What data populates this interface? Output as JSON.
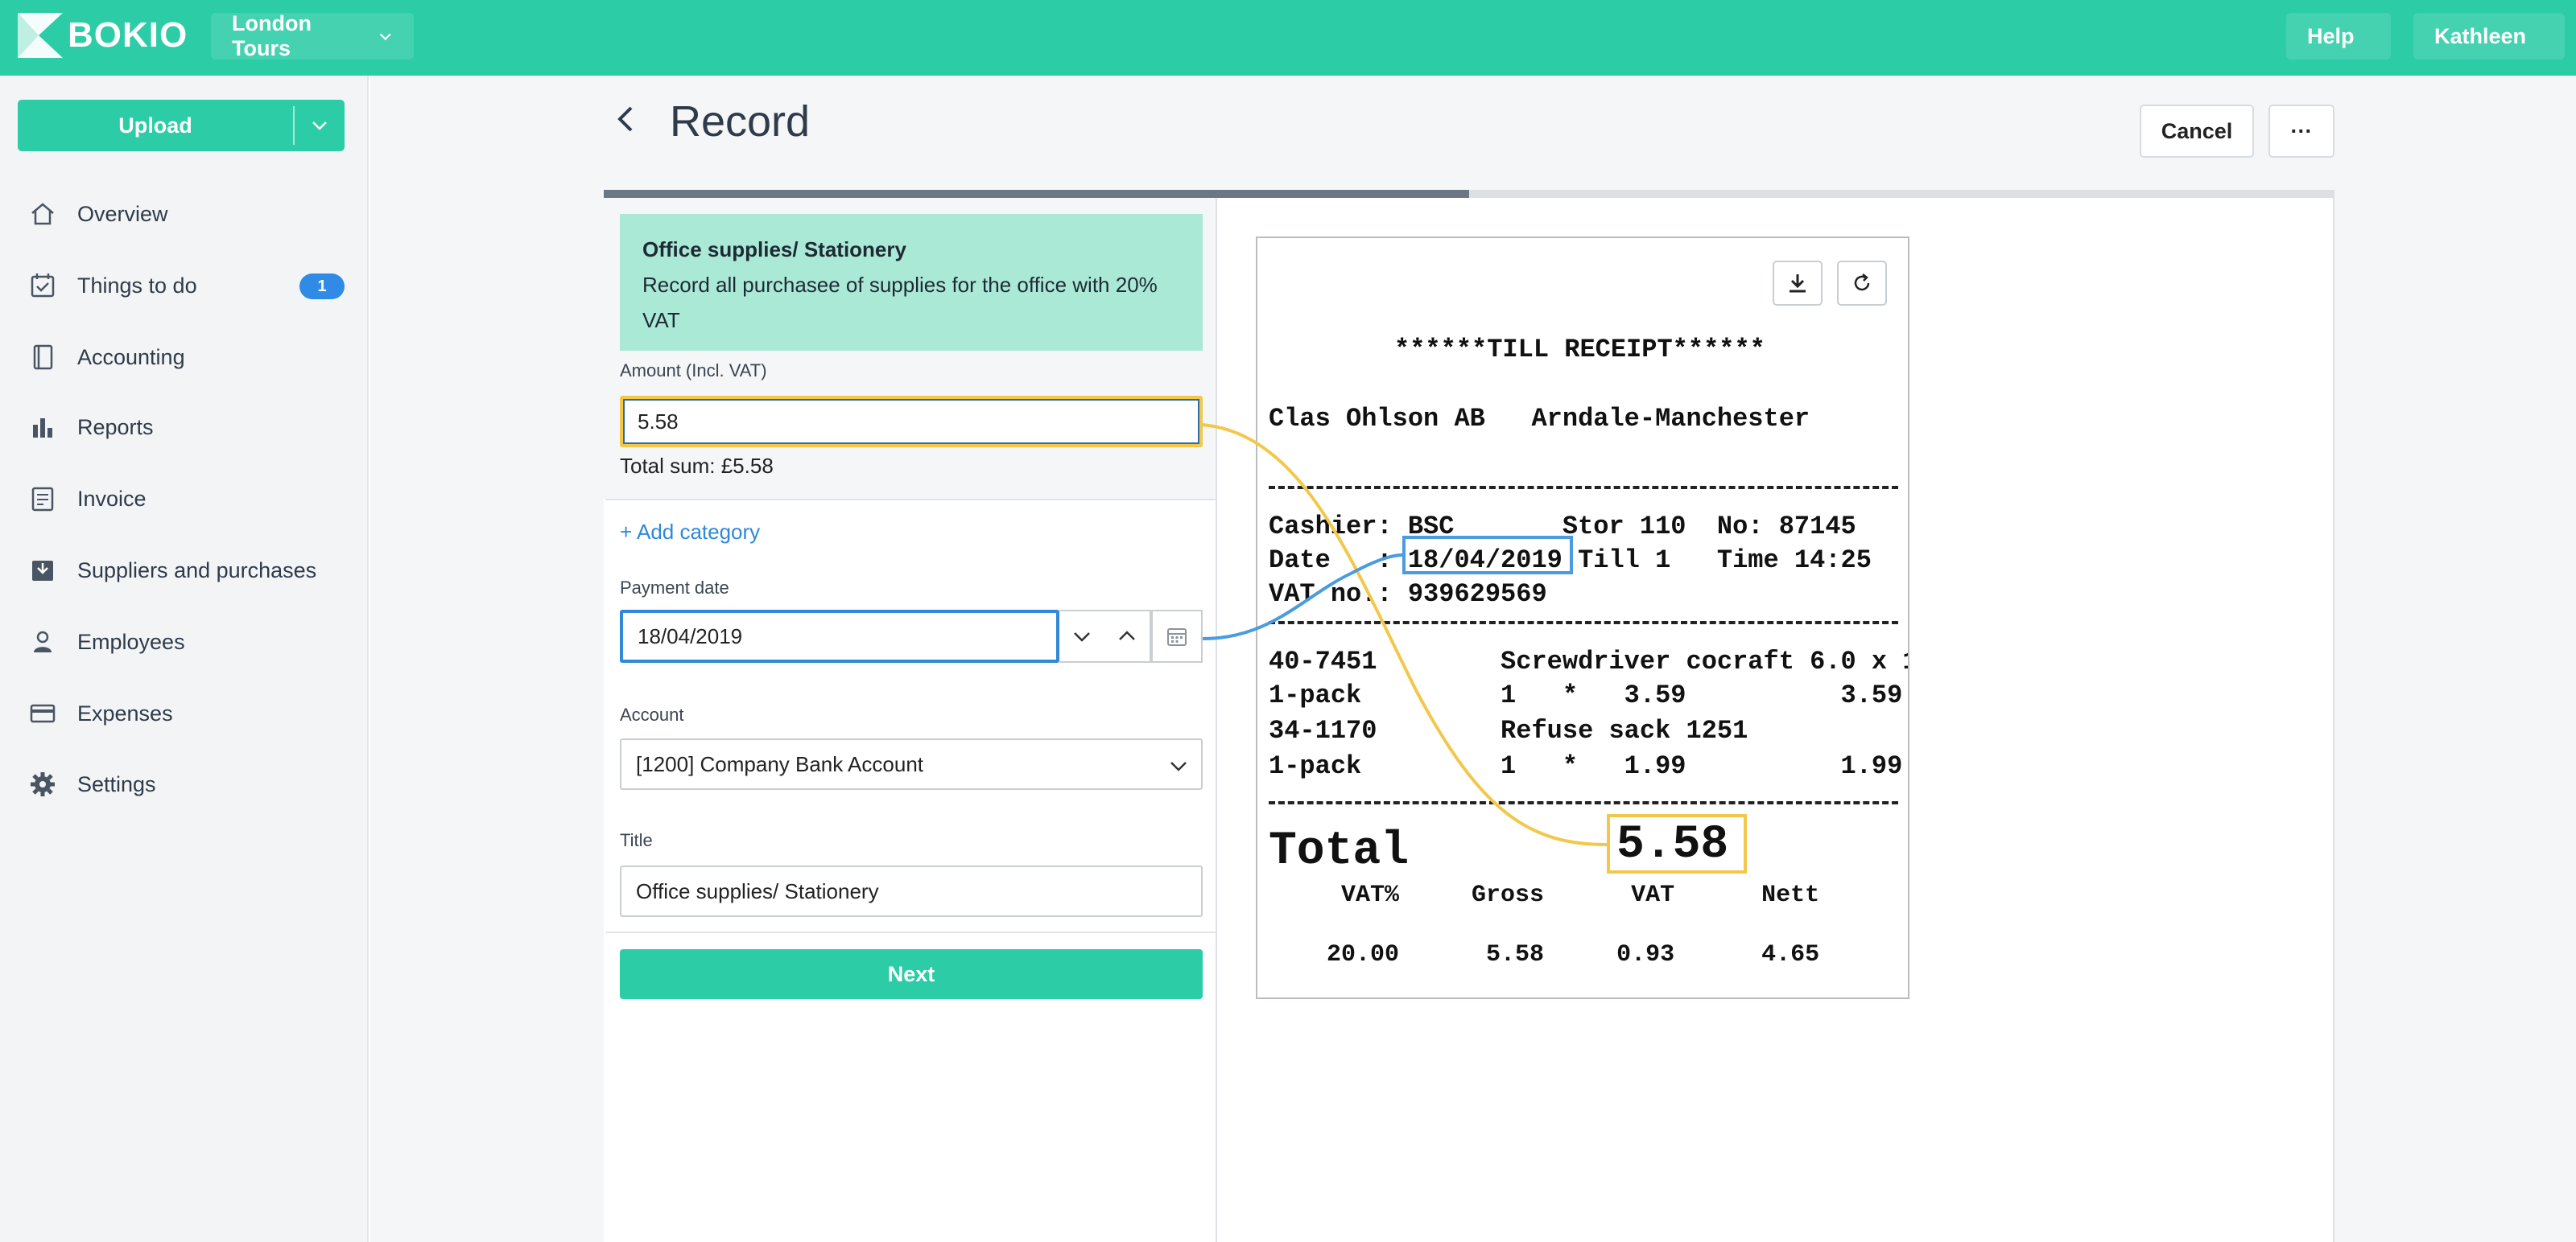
{
  "app": {
    "brand": "BOKIO",
    "company": "London Tours",
    "help": "Help",
    "user": "Kathleen"
  },
  "sidebar": {
    "upload_label": "Upload",
    "items": [
      {
        "label": "Overview",
        "icon": "home-icon"
      },
      {
        "label": "Things to do",
        "icon": "checklist-icon",
        "badge": "1"
      },
      {
        "label": "Accounting",
        "icon": "book-icon"
      },
      {
        "label": "Reports",
        "icon": "bar-chart-icon"
      },
      {
        "label": "Invoice",
        "icon": "invoice-icon"
      },
      {
        "label": "Suppliers and purchases",
        "icon": "inbox-icon"
      },
      {
        "label": "Employees",
        "icon": "person-icon"
      },
      {
        "label": "Expenses",
        "icon": "card-icon"
      },
      {
        "label": "Settings",
        "icon": "gear-icon"
      }
    ]
  },
  "page": {
    "title": "Record",
    "cancel_label": "Cancel",
    "more_label": "···",
    "progress": 0.5
  },
  "form": {
    "category_title": "Office supplies/ Stationery",
    "category_desc": "Record all purchasee of supplies for the office with 20% VAT",
    "amount_label": "Amount (Incl. VAT)",
    "amount_value": "5.58",
    "total_sum": "Total sum: £5.58",
    "add_category": "+ Add category",
    "payment_date_label": "Payment date",
    "payment_date_value": "18/04/2019",
    "account_label": "Account",
    "account_value": "[1200] Company Bank Account",
    "title_label": "Title",
    "title_value": "Office supplies/ Stationery",
    "next_label": "Next"
  },
  "receipt": {
    "heading": "******TILL RECEIPT******",
    "store": "Clas Ohlson AB   Arndale-Manchester",
    "cashier": "Cashier: BSC       Stor 110  No: 87145",
    "date_prefix": "Date   : ",
    "date_value": "18/04/2019",
    "date_suffix": " Till 1   Time 14:25",
    "vat_no": "VAT no.: 939629569",
    "item1": "40-7451        Screwdriver cocraft 6.0 x 1",
    "item1_qty": "1-pack         1   *   3.59          3.59",
    "item2": "34-1170        Refuse sack 1251",
    "item2_qty": "1-pack         1   *   1.99          1.99",
    "total_label": "Total",
    "total_value": "5.58",
    "tax_header": "     VAT%     Gross      VAT      Nett",
    "tax_values": "    20.00      5.58     0.93      4.65"
  },
  "colors": {
    "accent": "#2ccca7",
    "amount_highlight": "#f2c84b",
    "date_highlight": "#4a9be0",
    "link": "#2f88d8"
  }
}
